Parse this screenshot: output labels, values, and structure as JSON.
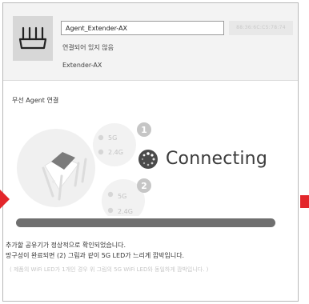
{
  "header": {
    "device_name_value": "Agent_Extender-AX",
    "mac_address": "88:36:6C:C5:78:74",
    "status": "연결되어 있지 않음",
    "model": "Extender-AX"
  },
  "section": {
    "title": "무선 Agent 연결"
  },
  "illustration": {
    "band_group_1": {
      "number": "1",
      "band_5g": "5G",
      "band_24g": "2.4G"
    },
    "band_group_2": {
      "number": "2",
      "band_5g": "5G",
      "band_24g": "2.4G"
    },
    "connecting_label": "Connecting"
  },
  "progress": {
    "value_percent": 100,
    "color": "#6f6f6f"
  },
  "messages": {
    "line1": "추가할 공유기가 정상적으로 확인되었습니다.",
    "line2": "망구성이 완료되면 (2) 그림과 같이 5G LED가 느리게 깜박입니다.",
    "note": "( 제품의 WiFi LED가 1개인 경우 위 그림의 5G WiFi LED와 동일하게 깜박입니다. )"
  },
  "colors": {
    "accent_red": "#e3262b",
    "header_bg": "#f3f3f3"
  },
  "icons": {
    "device": "router-icon",
    "spinner": "spinner-icon",
    "left_arrow": "arrow-right-icon"
  }
}
